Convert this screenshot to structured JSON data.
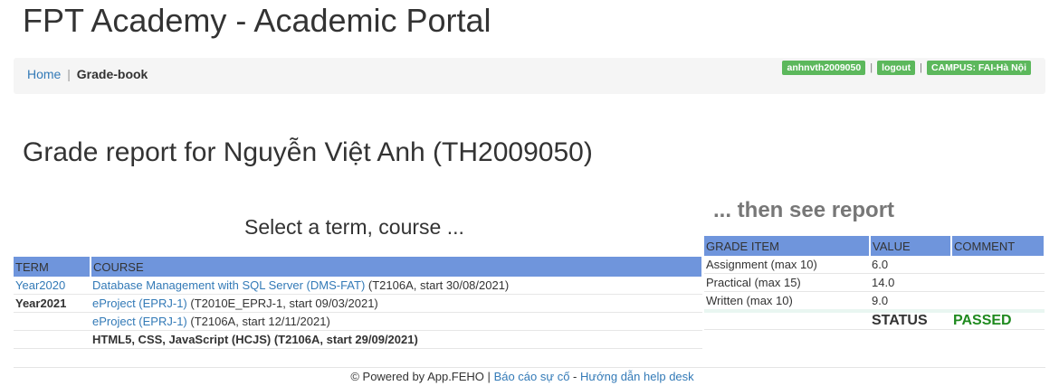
{
  "app": {
    "title": "FPT Academy - Academic Portal"
  },
  "breadcrumb": {
    "home": "Home",
    "separator": "|",
    "current": "Grade-book"
  },
  "user_badges": {
    "username": "anhnvth2009050",
    "logout": "logout",
    "campus": "CAMPUS: FAI-Hà Nội",
    "separator": "|"
  },
  "report": {
    "title": "Grade report for Nguyễn Việt Anh (TH2009050)"
  },
  "selection": {
    "heading": "Select a term, course ...",
    "columns": {
      "term": "TERM",
      "course": "COURSE"
    },
    "rows": [
      {
        "term": "Year2020",
        "course_link": "Database Management with SQL Server (DMS-FAT)",
        "course_detail": " (T2106A, start 30/08/2021)"
      },
      {
        "term": "Year2021",
        "course_link": "eProject (EPRJ-1)",
        "course_detail": " (T2010E_EPRJ-1, start 09/03/2021)"
      },
      {
        "term": "",
        "course_link": "eProject (EPRJ-1)",
        "course_detail": " (T2106A, start 12/11/2021)"
      },
      {
        "term": "",
        "course_text": "HTML5, CSS, JavaScript (HCJS) (T2106A, start 29/09/2021)"
      }
    ]
  },
  "grades": {
    "heading": "... then see report",
    "columns": {
      "item": "GRADE ITEM",
      "value": "VALUE",
      "comment": "COMMENT"
    },
    "items": [
      {
        "name": "Assignment (max 10)",
        "value": "6.0",
        "comment": ""
      },
      {
        "name": "Practical (max 15)",
        "value": "14.0",
        "comment": ""
      },
      {
        "name": "Written (max 10)",
        "value": "9.0",
        "comment": ""
      }
    ],
    "status_label": "STATUS",
    "status_value": "PASSED"
  },
  "footer": {
    "powered": "© Powered by App.FEHO",
    "separator1": "|",
    "report_issue": "Báo cáo sự cố",
    "separator2": "-",
    "help": "Hướng dẫn help desk"
  },
  "colors": {
    "header_blue": "#6f95dc",
    "badge_green": "#5cb85c",
    "link": "#337ab7",
    "passed": "#1f8a1f"
  }
}
